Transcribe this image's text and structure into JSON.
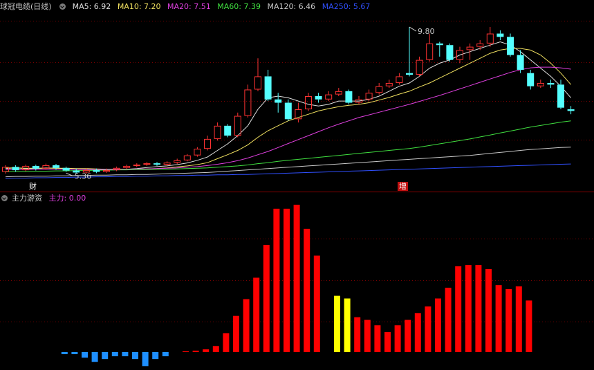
{
  "header1": {
    "title": "球冠电缆",
    "period": "(日线)",
    "indicators": [
      {
        "label": "MA5: 6.92",
        "color": "#e0e0e0"
      },
      {
        "label": "MA10: 7.20",
        "color": "#f0e060"
      },
      {
        "label": "MA20: 7.51",
        "color": "#e040e0"
      },
      {
        "label": "MA60: 7.39",
        "color": "#40e040"
      },
      {
        "label": "MA120: 6.46",
        "color": "#c8c8c8"
      },
      {
        "label": "MA250: 5.67",
        "color": "#3050ff"
      }
    ]
  },
  "header2": {
    "title": "主力游资",
    "value_label": "主力: 0.00",
    "value_color": "#e040e0"
  },
  "markers": {
    "left": "财",
    "right": "增"
  },
  "colors": {
    "up": "#ff3333",
    "down": "#54ffff",
    "bar_pos": "#ff0000",
    "bar_neg": "#1e8fff",
    "bar_hi": "#ffff00",
    "grid": "#7a0000"
  },
  "chart_data": [
    {
      "type": "candlestick",
      "annotations": [
        {
          "text": "9.80",
          "x": 40,
          "y": 9.8
        },
        {
          "text": "5.36",
          "x": 6,
          "y": 5.36
        }
      ],
      "ylim": [
        5.2,
        10.2
      ],
      "candles": [
        [
          5.4,
          5.55,
          5.35,
          5.6
        ],
        [
          5.55,
          5.45,
          5.4,
          5.6
        ],
        [
          5.45,
          5.58,
          5.42,
          5.62
        ],
        [
          5.58,
          5.5,
          5.44,
          5.62
        ],
        [
          5.5,
          5.6,
          5.46,
          5.65
        ],
        [
          5.6,
          5.52,
          5.46,
          5.64
        ],
        [
          5.52,
          5.44,
          5.4,
          5.56
        ],
        [
          5.44,
          5.38,
          5.34,
          5.5
        ],
        [
          5.38,
          5.45,
          5.34,
          5.5
        ],
        [
          5.45,
          5.4,
          5.36,
          5.5
        ],
        [
          5.4,
          5.45,
          5.37,
          5.5
        ],
        [
          5.45,
          5.52,
          5.42,
          5.56
        ],
        [
          5.52,
          5.58,
          5.48,
          5.62
        ],
        [
          5.58,
          5.62,
          5.54,
          5.66
        ],
        [
          5.62,
          5.66,
          5.58,
          5.7
        ],
        [
          5.66,
          5.62,
          5.58,
          5.7
        ],
        [
          5.62,
          5.68,
          5.58,
          5.72
        ],
        [
          5.68,
          5.75,
          5.64,
          5.8
        ],
        [
          5.75,
          5.9,
          5.72,
          5.94
        ],
        [
          5.9,
          6.1,
          5.86,
          6.15
        ],
        [
          6.1,
          6.4,
          6.05,
          6.5
        ],
        [
          6.4,
          6.8,
          6.35,
          6.9
        ],
        [
          6.8,
          6.5,
          6.45,
          6.85
        ],
        [
          6.5,
          7.1,
          6.45,
          7.2
        ],
        [
          7.1,
          7.9,
          7.05,
          8.05
        ],
        [
          7.9,
          8.3,
          7.85,
          8.85
        ],
        [
          8.3,
          7.6,
          7.55,
          8.5
        ],
        [
          7.6,
          7.5,
          7.2,
          7.8
        ],
        [
          7.5,
          7.0,
          6.95,
          7.6
        ],
        [
          7.0,
          7.3,
          6.9,
          7.5
        ],
        [
          7.3,
          7.7,
          7.25,
          7.8
        ],
        [
          7.7,
          7.6,
          7.5,
          7.8
        ],
        [
          7.6,
          7.75,
          7.55,
          7.85
        ],
        [
          7.75,
          7.85,
          7.7,
          7.95
        ],
        [
          7.85,
          7.5,
          7.45,
          7.9
        ],
        [
          7.5,
          7.6,
          7.45,
          7.7
        ],
        [
          7.6,
          7.8,
          7.55,
          7.9
        ],
        [
          7.8,
          8.0,
          7.75,
          8.1
        ],
        [
          8.0,
          8.1,
          7.95,
          8.2
        ],
        [
          8.1,
          8.3,
          8.05,
          8.4
        ],
        [
          8.4,
          8.35,
          8.3,
          9.8
        ],
        [
          8.35,
          8.8,
          8.3,
          8.9
        ],
        [
          8.8,
          9.3,
          8.75,
          9.6
        ],
        [
          9.3,
          9.25,
          8.9,
          9.35
        ],
        [
          9.25,
          8.8,
          8.75,
          9.3
        ],
        [
          8.8,
          9.1,
          8.7,
          9.2
        ],
        [
          9.1,
          9.2,
          8.8,
          9.3
        ],
        [
          9.2,
          9.3,
          9.1,
          9.4
        ],
        [
          9.3,
          9.6,
          9.2,
          9.8
        ],
        [
          9.6,
          9.5,
          9.4,
          9.7
        ],
        [
          9.5,
          8.95,
          8.9,
          9.6
        ],
        [
          8.95,
          8.5,
          8.4,
          9.1
        ],
        [
          8.4,
          8.0,
          7.9,
          8.5
        ],
        [
          8.0,
          8.1,
          7.95,
          8.2
        ],
        [
          8.1,
          8.05,
          7.95,
          8.2
        ],
        [
          8.05,
          7.35,
          7.3,
          8.2
        ],
        [
          7.3,
          7.25,
          7.15,
          7.4
        ]
      ],
      "ma": [
        {
          "name": "MA5",
          "color": "#e0e0e0",
          "values": [
            5.5,
            5.52,
            5.5,
            5.5,
            5.52,
            5.51,
            5.5,
            5.48,
            5.47,
            5.47,
            5.46,
            5.46,
            5.48,
            5.5,
            5.53,
            5.56,
            5.58,
            5.62,
            5.67,
            5.75,
            5.85,
            6.05,
            6.25,
            6.5,
            6.8,
            7.3,
            7.65,
            7.7,
            7.65,
            7.55,
            7.45,
            7.4,
            7.45,
            7.55,
            7.55,
            7.55,
            7.6,
            7.7,
            7.85,
            8.0,
            8.1,
            8.3,
            8.55,
            8.7,
            8.8,
            8.95,
            9.05,
            9.15,
            9.25,
            9.35,
            9.25,
            9.05,
            8.8,
            8.55,
            8.3,
            8.0,
            7.65
          ]
        },
        {
          "name": "MA10",
          "color": "#f0e060",
          "values": [
            5.52,
            5.52,
            5.51,
            5.51,
            5.51,
            5.51,
            5.51,
            5.5,
            5.5,
            5.49,
            5.48,
            5.48,
            5.48,
            5.48,
            5.49,
            5.5,
            5.52,
            5.55,
            5.58,
            5.62,
            5.68,
            5.8,
            5.92,
            6.05,
            6.22,
            6.45,
            6.65,
            6.8,
            6.95,
            7.05,
            7.15,
            7.25,
            7.32,
            7.38,
            7.42,
            7.45,
            7.5,
            7.58,
            7.66,
            7.76,
            7.85,
            7.98,
            8.1,
            8.25,
            8.4,
            8.55,
            8.7,
            8.85,
            9.0,
            9.1,
            9.15,
            9.15,
            9.1,
            8.95,
            8.7,
            8.4,
            8.05
          ]
        },
        {
          "name": "MA20",
          "color": "#e040e0",
          "values": [
            5.46,
            5.47,
            5.47,
            5.48,
            5.48,
            5.48,
            5.48,
            5.48,
            5.48,
            5.48,
            5.48,
            5.48,
            5.48,
            5.49,
            5.49,
            5.5,
            5.51,
            5.52,
            5.54,
            5.56,
            5.59,
            5.63,
            5.68,
            5.74,
            5.82,
            5.92,
            6.02,
            6.14,
            6.26,
            6.38,
            6.5,
            6.62,
            6.74,
            6.85,
            6.95,
            7.05,
            7.13,
            7.21,
            7.29,
            7.37,
            7.45,
            7.54,
            7.63,
            7.72,
            7.82,
            7.92,
            8.02,
            8.12,
            8.22,
            8.32,
            8.42,
            8.5,
            8.56,
            8.58,
            8.58,
            8.56,
            8.52
          ]
        },
        {
          "name": "MA60",
          "color": "#40e040",
          "values": [
            5.4,
            5.41,
            5.41,
            5.42,
            5.42,
            5.43,
            5.43,
            5.44,
            5.44,
            5.45,
            5.45,
            5.46,
            5.46,
            5.47,
            5.47,
            5.48,
            5.48,
            5.49,
            5.5,
            5.51,
            5.52,
            5.54,
            5.56,
            5.58,
            5.61,
            5.65,
            5.68,
            5.72,
            5.75,
            5.78,
            5.81,
            5.84,
            5.87,
            5.9,
            5.93,
            5.96,
            5.99,
            6.02,
            6.05,
            6.08,
            6.11,
            6.15,
            6.2,
            6.25,
            6.3,
            6.35,
            6.4,
            6.46,
            6.52,
            6.58,
            6.64,
            6.7,
            6.76,
            6.81,
            6.86,
            6.91,
            6.95
          ]
        },
        {
          "name": "MA120",
          "color": "#c8c8c8",
          "values": [
            5.25,
            5.26,
            5.26,
            5.27,
            5.27,
            5.28,
            5.28,
            5.29,
            5.29,
            5.3,
            5.3,
            5.31,
            5.31,
            5.32,
            5.32,
            5.33,
            5.34,
            5.35,
            5.36,
            5.37,
            5.38,
            5.4,
            5.42,
            5.44,
            5.46,
            5.48,
            5.5,
            5.52,
            5.54,
            5.56,
            5.58,
            5.6,
            5.62,
            5.64,
            5.66,
            5.68,
            5.7,
            5.72,
            5.74,
            5.76,
            5.78,
            5.8,
            5.82,
            5.84,
            5.86,
            5.88,
            5.9,
            5.93,
            5.96,
            5.99,
            6.02,
            6.05,
            6.08,
            6.1,
            6.12,
            6.14,
            6.15
          ]
        },
        {
          "name": "MA250",
          "color": "#3050ff",
          "values": [
            5.2,
            5.21,
            5.21,
            5.22,
            5.22,
            5.23,
            5.23,
            5.24,
            5.24,
            5.25,
            5.25,
            5.26,
            5.26,
            5.27,
            5.27,
            5.28,
            5.28,
            5.29,
            5.29,
            5.3,
            5.3,
            5.31,
            5.31,
            5.32,
            5.32,
            5.33,
            5.34,
            5.35,
            5.36,
            5.37,
            5.38,
            5.39,
            5.4,
            5.41,
            5.42,
            5.43,
            5.44,
            5.45,
            5.46,
            5.47,
            5.48,
            5.49,
            5.5,
            5.51,
            5.52,
            5.53,
            5.54,
            5.55,
            5.56,
            5.57,
            5.58,
            5.59,
            5.6,
            5.61,
            5.62,
            5.63,
            5.64
          ]
        }
      ]
    },
    {
      "type": "bar",
      "ylim": [
        -2,
        22
      ],
      "values": [
        0,
        0,
        0,
        -0.3,
        -0.3,
        -0.8,
        -1.4,
        -1.0,
        -0.6,
        -0.6,
        -1.0,
        -2.0,
        -1.0,
        -0.6,
        0,
        0.1,
        0.2,
        0.4,
        0.9,
        2.8,
        5.4,
        7.9,
        11.1,
        16.0,
        21.4,
        21.4,
        22.0,
        18.4,
        14.4,
        0,
        8.4,
        8.0,
        5.2,
        4.8,
        4.0,
        3.0,
        4.0,
        4.8,
        5.8,
        6.8,
        8.0,
        9.6,
        12.8,
        13.0,
        13.0,
        12.4,
        10.0,
        9.4,
        9.8,
        7.7
      ],
      "highlight_indices": [
        30,
        31
      ]
    }
  ]
}
